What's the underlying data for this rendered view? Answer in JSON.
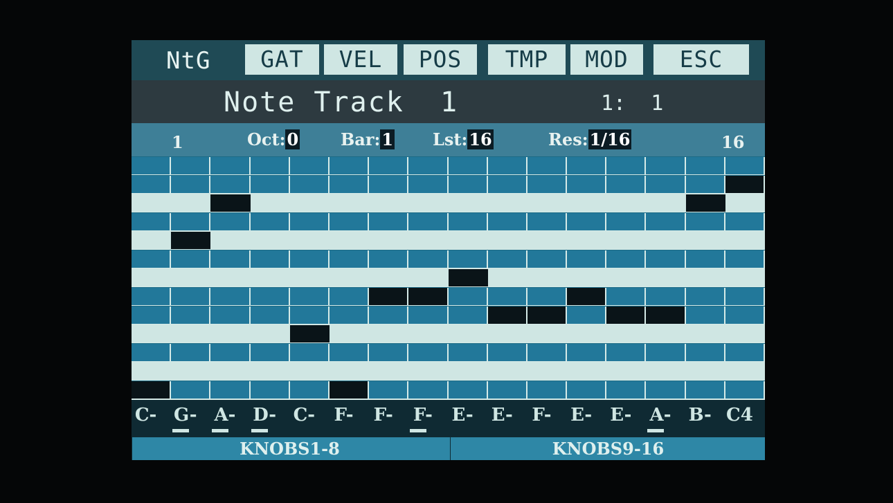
{
  "topbar": {
    "title": "NtG",
    "buttons": [
      "GAT",
      "VEL",
      "POS",
      "TMP",
      "MOD",
      "ESC"
    ]
  },
  "header": {
    "track_name": "Note Track  1",
    "position": "1:  1"
  },
  "params": {
    "step_first": "1",
    "step_last": "16",
    "oct_label": "Oct:",
    "oct_value": "0",
    "bar_label": "Bar:",
    "bar_value": "1",
    "lst_label": "Lst:",
    "lst_value": "16",
    "res_label": "Res:",
    "res_value": "1/16"
  },
  "grid": {
    "steps": 16,
    "rows": [
      {
        "light": false,
        "active": []
      },
      {
        "light": false,
        "active": [
          15
        ]
      },
      {
        "light": true,
        "active": [
          2,
          14
        ]
      },
      {
        "light": false,
        "active": []
      },
      {
        "light": true,
        "active": [
          1
        ]
      },
      {
        "light": false,
        "active": []
      },
      {
        "light": true,
        "active": [
          8
        ]
      },
      {
        "light": false,
        "active": [
          6,
          7,
          11
        ]
      },
      {
        "light": false,
        "active": [
          9,
          10,
          12,
          13
        ]
      },
      {
        "light": true,
        "active": [
          4
        ]
      },
      {
        "light": false,
        "active": []
      },
      {
        "light": true,
        "active": []
      },
      {
        "light": false,
        "active": [
          0,
          5
        ]
      }
    ]
  },
  "notes": [
    {
      "label": "C-",
      "underlined": false
    },
    {
      "label": "G-",
      "underlined": true
    },
    {
      "label": "A-",
      "underlined": true
    },
    {
      "label": "D-",
      "underlined": true
    },
    {
      "label": "C-",
      "underlined": false
    },
    {
      "label": "F-",
      "underlined": false
    },
    {
      "label": "F-",
      "underlined": false
    },
    {
      "label": "F-",
      "underlined": true
    },
    {
      "label": "E-",
      "underlined": false
    },
    {
      "label": "E-",
      "underlined": false
    },
    {
      "label": "F-",
      "underlined": false
    },
    {
      "label": "E-",
      "underlined": false
    },
    {
      "label": "E-",
      "underlined": false
    },
    {
      "label": "A-",
      "underlined": true
    },
    {
      "label": "B-",
      "underlined": false
    },
    {
      "label": "C4",
      "underlined": false
    }
  ],
  "knobs": {
    "left": "KNOBS1-8",
    "right": "KNOBS9-16"
  },
  "colors": {
    "accent": "#cfe6e3",
    "grid_dark": "#22789a",
    "grid_active": "#0a1418"
  }
}
